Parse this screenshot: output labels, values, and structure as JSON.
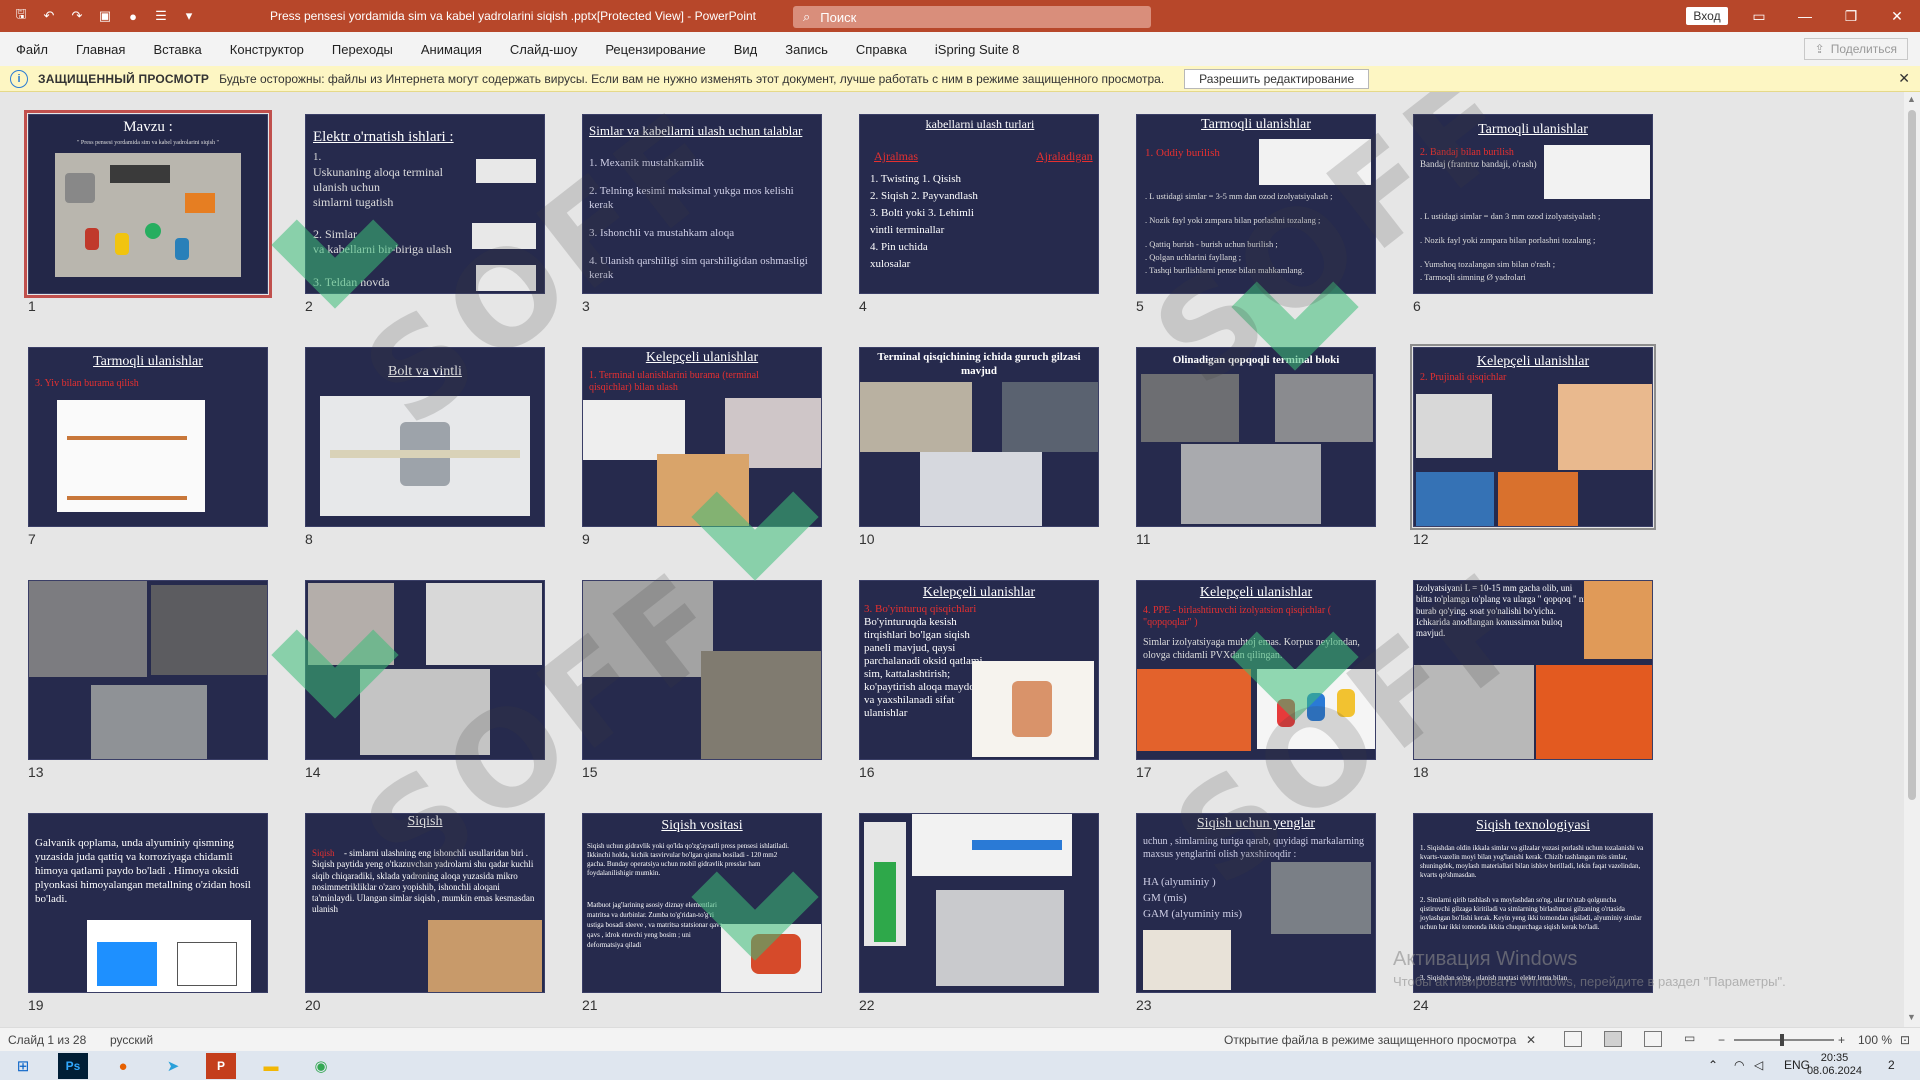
{
  "titlebar": {
    "title": "Press pensesi yordamida sim va kabel yadrolarini siqish .pptx[Protected View] - PowerPoint",
    "search_placeholder": "Поиск",
    "login_label": "Вход"
  },
  "menu": [
    "Файл",
    "Главная",
    "Вставка",
    "Конструктор",
    "Переходы",
    "Анимация",
    "Слайд-шоу",
    "Рецензирование",
    "Вид",
    "Запись",
    "Справка",
    "iSpring Suite 8"
  ],
  "share_label": "Поделиться",
  "protected": {
    "title": "ЗАЩИЩЕННЫЙ ПРОСМОТР",
    "message": "Будьте осторожны: файлы из Интернета могут содержать вирусы. Если вам не нужно изменять этот документ, лучше работать с ним в режиме защищенного просмотра.",
    "button": "Разрешить редактирование"
  },
  "slides": [
    {
      "num": "1",
      "title": "Mavzu :",
      "sub": "\" Press pensesi yordamida sim va kabel yadrolarini siqish \""
    },
    {
      "num": "2",
      "title": "Elektr o'rnatish ishlari :",
      "l1": "1.",
      "l2": "Uskunaning aloqa terminal",
      "l3": "ulanish uchun",
      "l4": "simlarni tugatish",
      "l5": "2. Simlar",
      "l6": "va kabellarni bir-biriga ulash",
      "l7": "3. Teldan novda"
    },
    {
      "num": "3",
      "title": "Simlar va kabellarni ulash uchun talablar",
      "l1": "1. Mexanik mustahkamlik",
      "l2": "2. Telning kesimi maksimal yukga mos kelishi kerak",
      "l3": "3. Ishonchli va mustahkam aloqa",
      "l4": "4. Ulanish qarshiligi sim qarshiligidan oshmasligi kerak"
    },
    {
      "num": "4",
      "title": "kabellarni ulash turlari",
      "r1": "Ajralmas",
      "r2": "Ajraladigan",
      "l1": "1. Twisting 1. Qisish",
      "l2": "2. Siqish 2. Payvandlash",
      "l3": "3. Bolti yoki 3. Lehimli",
      "l4": "vintli terminallar",
      "l5": "4. Pin uchida",
      "l6": "xulosalar"
    },
    {
      "num": "5",
      "title": "Tarmoqli ulanishlar",
      "r1": "1. Oddiy burilish",
      "l1": ". L ustidagi simlar = 3-5 mm dan ozod izolyatsiyalash ;",
      "l2": ". Nozik fayl yoki zımpara bilan porlashni tozalang ;",
      "l3": ". Qattiq burish - burish uchun burilish ;",
      "l4": ". Qolgan uchlarini fayllang ;",
      "l5": ". Tashqi burilishlarni pense bilan mahkamlang."
    },
    {
      "num": "6",
      "title": "Tarmoqli ulanishlar",
      "r1": "2. Bandaj bilan burilish",
      "l0": "Bandaj (frantruz bandaji, o'rash)",
      "l1": ". L ustidagi simlar = dan 3 mm ozod izolyatsiyalash ;",
      "l2": ". Nozik fayl yoki zımpara bilan porlashni tozalang ;",
      "l3": ". Yumshoq tozalangan sim bilan o'rash ;",
      "l4": ". Tarmoqli simning Ø yadrolari"
    },
    {
      "num": "7",
      "title": "Tarmoqli ulanishlar",
      "r1": "3. Yiv bilan burama qilish"
    },
    {
      "num": "8",
      "title": "Bolt va vintli"
    },
    {
      "num": "9",
      "title": "Kelepçeli ulanishlar",
      "r1": "1. Terminal ulanishlarini burama (terminal qisqichlar) bilan ulash"
    },
    {
      "num": "10",
      "title": "Terminal qisqichining ichida guruch gilzasi mavjud"
    },
    {
      "num": "11",
      "title": "Olinadigan qopqoqli terminal bloki"
    },
    {
      "num": "12",
      "title": "Kelepçeli ulanishlar",
      "r1": "2. Prujinali qisqichlar"
    },
    {
      "num": "13"
    },
    {
      "num": "14"
    },
    {
      "num": "15"
    },
    {
      "num": "16",
      "title": "Kelepçeli ulanishlar",
      "r1": "3. Bo'yinturuq qisqichlari",
      "l1": "Bo'yinturuqda kesish tirqishlari bo'lgan siqish paneli mavjud, qaysi parchalanadi oksid qatlami sim, kattalashtirish; ko'paytirish aloqa maydoni va yaxshilanadi sifat ulanishlar"
    },
    {
      "num": "17",
      "title": "Kelepçeli ulanishlar",
      "r1": "4. PPE - birlashtiruvchi izolyatsion qisqichlar ( \"qopqoqlar\" )",
      "l1": "Simlar izolyatsiyaga muhtoj emas. Korpus neylondan, olovga chidamli PVXdan qilingan."
    },
    {
      "num": "18",
      "l1": "Izolyatsiyani L = 10-15 mm gacha olib, uni bitta to'plamga to'plang va ularga \" qopqoq \" ni burab qo'ying. soat yo'nalishi bo'yicha. Ichkarida anodlangan konussimon buloq mavjud."
    },
    {
      "num": "19",
      "l1": "Galvanik qoplama, unda alyuminiy qismning yuzasida juda qattiq va korroziyaga chidamli himoya qatlami paydo bo'ladi . Himoya oksidi plyonkasi himoyalangan metallning o'zidan hosil bo'ladi."
    },
    {
      "num": "20",
      "title": "Siqish",
      "r1": "Siqish",
      "l1": "- simlarni ulashning eng ishonchli usullaridan biri . Siqish paytida yeng o'tkazuvchan yadrolarni shu qadar kuchli siqib chiqaradiki, sklada yadroning aloqa yuzasida mikro nosimmetrikliklar o'zaro yopishib, ishonchli aloqani ta'minlaydi. Ulangan simlar siqish , mumkin emas kesmasdan ulanish"
    },
    {
      "num": "21",
      "title": "Siqish vositasi",
      "l1": "Siqish uchun gidravlik yoki qo'lda qo'zg'aysatli press pensesi ishlatiladi. Ikkinchi holda, kichik tasvirvular bo'lgan qisma bosiladi - 120 mm2 gacha. Bunday operatsiya uchun mobil gidravlik presslar ham foydalanilishigir mumkin.",
      "l2": "Matbuot jag'larining asosiy diznay elementlari matritsa va durbinlar. Zumba to'g'ridan-to'g'ri ustiga bosadi sleeve , va matritsa statsionar qavs qavs , idrok etuvchi yeng bosim ; uni deformatsiya qiladi"
    },
    {
      "num": "22"
    },
    {
      "num": "23",
      "title": "Siqish uchun yenglar",
      "l1": "uchun , simlarning turiga qarab, quyidagi markalarning maxsus yenglarini olish yaxshiroqdir :",
      "l2": "HA (alyuminiy )",
      "l3": "GM (mis)",
      "l4": "GAM (alyuminiy mis)"
    },
    {
      "num": "24",
      "title": "Siqish texnologiyasi",
      "l1": "1. Siqishdan oldin ikkala simlar va gilzalar yuzasi porlashi uchun tozalanishi va kvarts-vazelin moyi bilan yog'lanishi kerak. Chizib tashlangan mis simlar, shuningdek, moylash materiallari bilan ishlov berilladi, lekin faqat vazelindan, kvarts qo'shmasdan.",
      "l2": "2. Simlarni qirib tashlash va moylashdan so'ng, ular to'xtab qolguncha qistiruvchi gilzaga kiritiladi va simlarning birlashmasi gilzaning o'rtasida joylashgan bo'lishi kerak. Keyin yeng ikki tomondan qisiladi, alyuminiy simlar uchun har ikki tomonda ikkita chuqurchaga siqish kerak bo'ladi.",
      "l3": "3. Siqishdan so'ng , ulanish nuqtasi elektr lenta bilan"
    }
  ],
  "watermark": "SOFF",
  "activate": {
    "title": "Активация Windows",
    "sub": "Чтобы активировать Windows, перейдите в раздел \"Параметры\"."
  },
  "status": {
    "slide_count": "Слайд 1 из 28",
    "language": "русский",
    "protected_msg": "Открытие файла в режиме защищенного просмотра",
    "zoom": "100 %"
  },
  "taskbar": {
    "lang": "ENG",
    "time": "20:35",
    "date": "08.06.2024",
    "notif_count": "2"
  },
  "colors": {
    "accent": "#b7472a",
    "slide_bg": "#262a4d",
    "alert": "#e53030"
  }
}
